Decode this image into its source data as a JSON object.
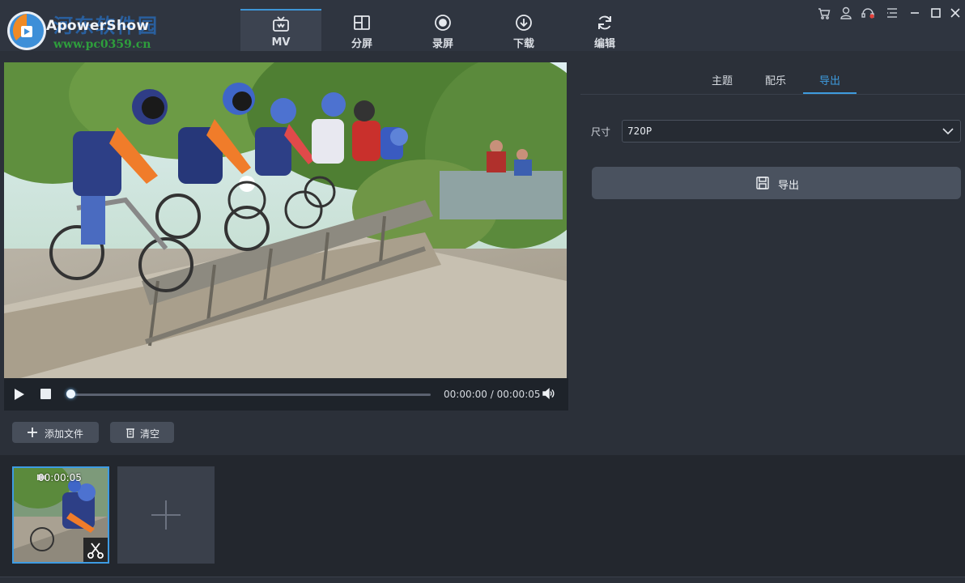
{
  "app": {
    "title": "ApowerShow"
  },
  "watermark": {
    "site_name": "河东软件园",
    "url": "www.pc0359.cn"
  },
  "tabs": [
    {
      "label": "MV",
      "icon": "tv-icon",
      "active": true
    },
    {
      "label": "分屏",
      "icon": "split-screen-icon",
      "active": false
    },
    {
      "label": "录屏",
      "icon": "record-icon",
      "active": false
    },
    {
      "label": "下载",
      "icon": "download-icon",
      "active": false
    },
    {
      "label": "编辑",
      "icon": "refresh-icon",
      "active": false
    }
  ],
  "window_controls": [
    "cart-icon",
    "user-icon",
    "support-icon",
    "menu-icon",
    "minimize-icon",
    "maximize-icon",
    "close-icon"
  ],
  "player": {
    "current_time": "00:00:00",
    "total_time": "00:00:05",
    "time_separator": "/",
    "progress": 0
  },
  "settings": {
    "tabs": [
      {
        "label": "主题",
        "active": false
      },
      {
        "label": "配乐",
        "active": false
      },
      {
        "label": "导出",
        "active": true
      }
    ],
    "size_label": "尺寸",
    "size_value": "720P",
    "export_button": "导出"
  },
  "toolbar": {
    "add_files": "添加文件",
    "clear": "清空"
  },
  "media": [
    {
      "duration": "00:00:05",
      "selected": true
    }
  ],
  "colors": {
    "accent": "#3e9bde",
    "background": "#2b3039",
    "panel_dark": "#23272e"
  }
}
